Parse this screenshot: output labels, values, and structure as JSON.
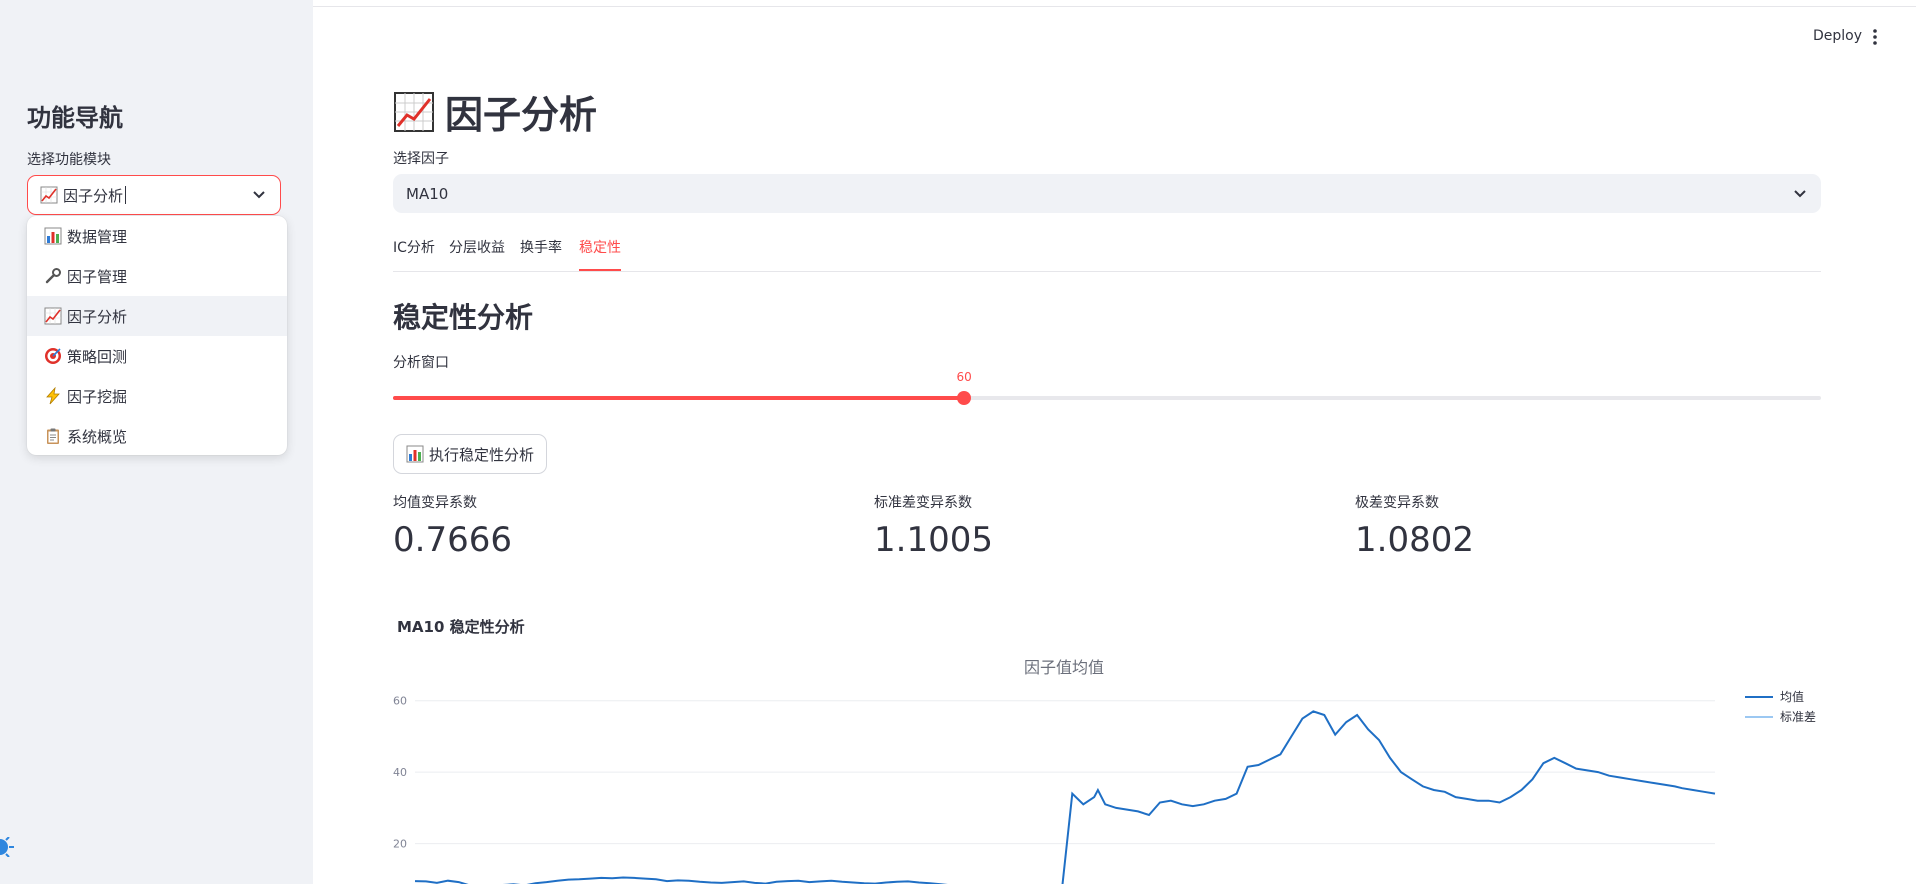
{
  "sidebar": {
    "title": "功能导航",
    "select_label": "选择功能模块",
    "selected": "因子分析",
    "options": [
      {
        "label": "数据管理",
        "icon": "bar-chart-icon"
      },
      {
        "label": "因子管理",
        "icon": "wrench-icon"
      },
      {
        "label": "因子分析",
        "icon": "chart-increasing-icon"
      },
      {
        "label": "策略回测",
        "icon": "target-icon"
      },
      {
        "label": "因子挖掘",
        "icon": "lightning-icon"
      },
      {
        "label": "系统概览",
        "icon": "clipboard-icon"
      }
    ]
  },
  "header": {
    "deploy_label": "Deploy"
  },
  "main": {
    "title": "因子分析",
    "factor_label": "选择因子",
    "factor_value": "MA10",
    "tabs": [
      {
        "label": "IC分析"
      },
      {
        "label": "分层收益"
      },
      {
        "label": "换手率"
      },
      {
        "label": "稳定性",
        "active": true
      }
    ],
    "section_title": "稳定性分析",
    "window_label": "分析窗口",
    "window_value": "60",
    "window_fraction": 0.4,
    "run_button": "执行稳定性分析",
    "metrics": [
      {
        "label": "均值变异系数",
        "value": "0.7666"
      },
      {
        "label": "标准差变异系数",
        "value": "1.1005"
      },
      {
        "label": "极差变异系数",
        "value": "1.0802"
      }
    ],
    "chart_heading": "MA10 稳定性分析"
  },
  "colors": {
    "accent": "#ff4b4b",
    "mean_line": "#1f6fc5",
    "std_line": "#9cc8f2"
  },
  "chart_data": {
    "type": "line",
    "title": "因子值均值",
    "ylim": [
      0,
      70
    ],
    "yticks": [
      20,
      40,
      60
    ],
    "grid": true,
    "legend_position": "top-right",
    "series": [
      {
        "name": "均值",
        "x": [
          0,
          3,
          6,
          9,
          12,
          15,
          18,
          21,
          24,
          27,
          30,
          33,
          36,
          39,
          42,
          45,
          48,
          51,
          54,
          57,
          60,
          63,
          66,
          69,
          72,
          75,
          78,
          81,
          84,
          87,
          90,
          93,
          96,
          99,
          102,
          105,
          108,
          111,
          114,
          117,
          120,
          123,
          126,
          129,
          132,
          135,
          138,
          141,
          144,
          147,
          150,
          153,
          156,
          159,
          162,
          165,
          168,
          171,
          174,
          177,
          180,
          183,
          186,
          187,
          189,
          192,
          195,
          198,
          201,
          204,
          207,
          210,
          213,
          216,
          219,
          222,
          225,
          228,
          231,
          234,
          237,
          240,
          243,
          246,
          249,
          252,
          255,
          258,
          261,
          264,
          267,
          270,
          273,
          276,
          279,
          282,
          285,
          288,
          291,
          294,
          297,
          300,
          303,
          306,
          309,
          312,
          315,
          318,
          321,
          324,
          327,
          330,
          333,
          336,
          339,
          342,
          345,
          347,
          350,
          353,
          356
        ],
        "values": [
          9.5,
          9.4,
          9.0,
          9.6,
          9.2,
          8.3,
          8.1,
          8.2,
          8.4,
          8.6,
          8.3,
          8.9,
          9.2,
          9.6,
          9.9,
          10.0,
          10.2,
          10.4,
          10.3,
          10.5,
          10.4,
          10.2,
          10.0,
          9.5,
          9.7,
          9.6,
          9.3,
          9.1,
          9.0,
          9.2,
          9.4,
          9.0,
          8.8,
          9.3,
          9.5,
          9.6,
          9.2,
          9.4,
          9.6,
          9.3,
          9.1,
          8.9,
          8.8,
          9.1,
          9.3,
          9.4,
          9.1,
          8.9,
          8.6,
          8.3,
          8.0,
          7.6,
          7.2,
          7.0,
          6.9,
          7.1,
          7.3,
          7.2,
          5.5,
          5.5,
          34.0,
          31.0,
          33.0,
          35.0,
          31.0,
          30.0,
          29.5,
          29.0,
          28.0,
          31.5,
          32.0,
          31.0,
          30.5,
          31.0,
          32.0,
          32.5,
          34.0,
          41.5,
          42.0,
          43.5,
          45.0,
          50.0,
          55.0,
          57.0,
          56.0,
          50.5,
          54.0,
          56.0,
          52.0,
          49.0,
          44.0,
          40.0,
          38.0,
          36.0,
          35.0,
          34.5,
          33.0,
          32.5,
          32.0,
          32.0,
          31.5,
          33.0,
          35.0,
          38.0,
          42.5,
          44.0,
          42.5,
          41.0,
          40.5,
          40.0,
          39.0,
          38.5,
          38.0,
          37.5,
          37.0,
          36.5,
          36.0,
          35.5,
          35.0,
          34.5,
          34.0
        ]
      },
      {
        "name": "标准差",
        "values": []
      }
    ]
  }
}
